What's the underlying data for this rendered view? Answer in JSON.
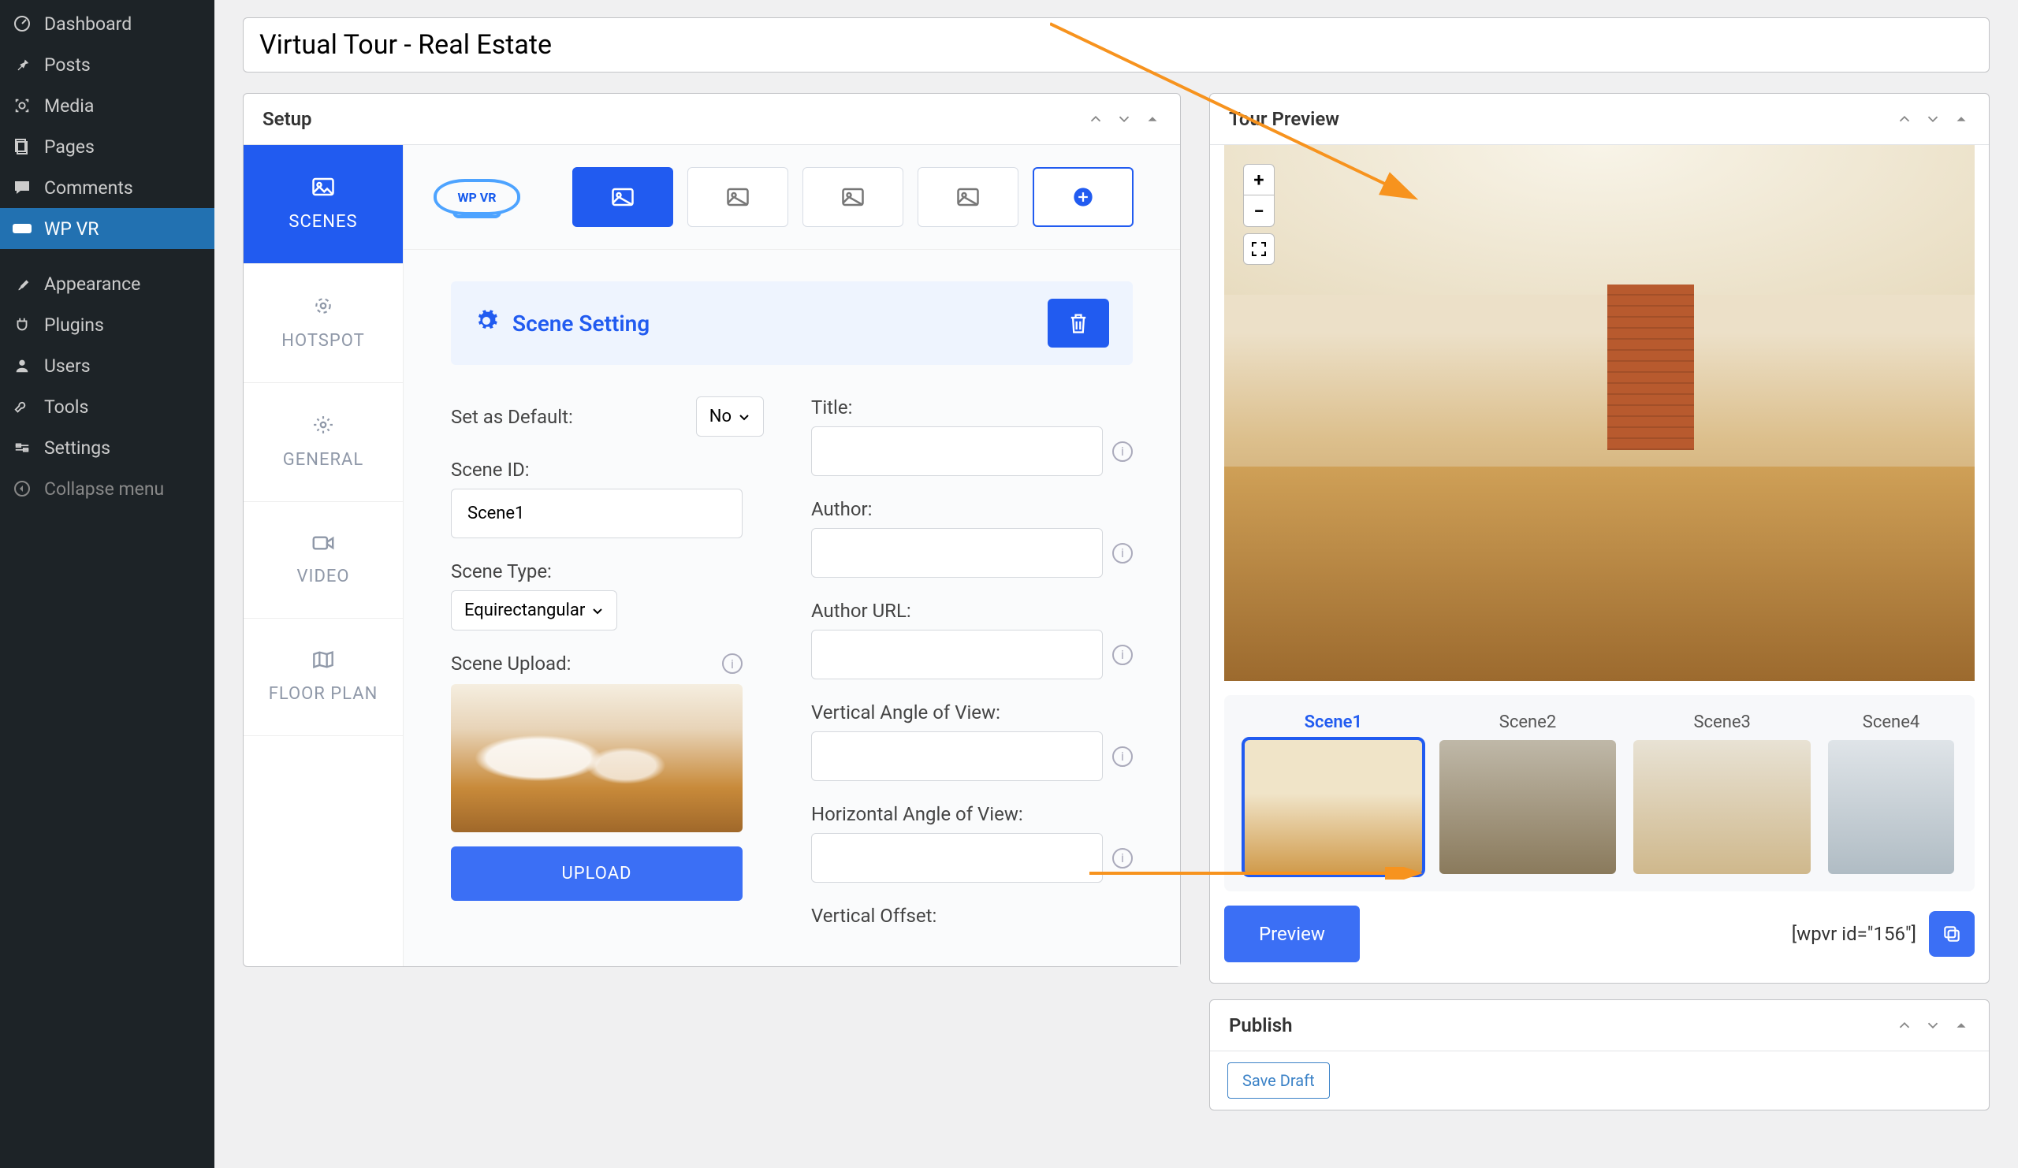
{
  "sidebar": {
    "items": [
      {
        "label": "Dashboard",
        "icon": "dashboard-icon"
      },
      {
        "label": "Posts",
        "icon": "pin-icon"
      },
      {
        "label": "Media",
        "icon": "media-icon"
      },
      {
        "label": "Pages",
        "icon": "pages-icon"
      },
      {
        "label": "Comments",
        "icon": "comments-icon"
      },
      {
        "label": "WP VR",
        "icon": "vr-icon",
        "active": true
      },
      {
        "label": "Appearance",
        "icon": "brush-icon",
        "sep_before": true
      },
      {
        "label": "Plugins",
        "icon": "plug-icon"
      },
      {
        "label": "Users",
        "icon": "users-icon"
      },
      {
        "label": "Tools",
        "icon": "tools-icon"
      },
      {
        "label": "Settings",
        "icon": "settings-icon"
      },
      {
        "label": "Collapse menu",
        "icon": "collapse-icon"
      }
    ]
  },
  "title": "Virtual Tour - Real Estate",
  "setup": {
    "panel_title": "Setup",
    "logo_text": "WP VR",
    "vtabs": [
      {
        "key": "scenes",
        "label": "SCENES"
      },
      {
        "key": "hotspot",
        "label": "HOTSPOT"
      },
      {
        "key": "general",
        "label": "GENERAL"
      },
      {
        "key": "video",
        "label": "VIDEO"
      },
      {
        "key": "floor",
        "label": "FLOOR PLAN"
      }
    ],
    "scene_setting_title": "Scene Setting",
    "fields": {
      "set_default_label": "Set as Default:",
      "set_default_value": "No",
      "scene_id_label": "Scene ID:",
      "scene_id_value": "Scene1",
      "scene_type_label": "Scene Type:",
      "scene_type_value": "Equirectangular",
      "scene_upload_label": "Scene Upload:",
      "upload_btn": "UPLOAD",
      "title_label": "Title:",
      "author_label": "Author:",
      "author_url_label": "Author URL:",
      "vaov_label": "Vertical Angle of View:",
      "haov_label": "Horizontal Angle of View:",
      "voffset_label": "Vertical Offset:"
    }
  },
  "preview": {
    "panel_title": "Tour Preview",
    "zoom_in": "+",
    "zoom_out": "−",
    "scenes": [
      "Scene1",
      "Scene2",
      "Scene3",
      "Scene4"
    ],
    "preview_btn": "Preview",
    "shortcode": "[wpvr id=\"156\"]"
  },
  "publish": {
    "panel_title": "Publish",
    "save_draft": "Save Draft"
  }
}
